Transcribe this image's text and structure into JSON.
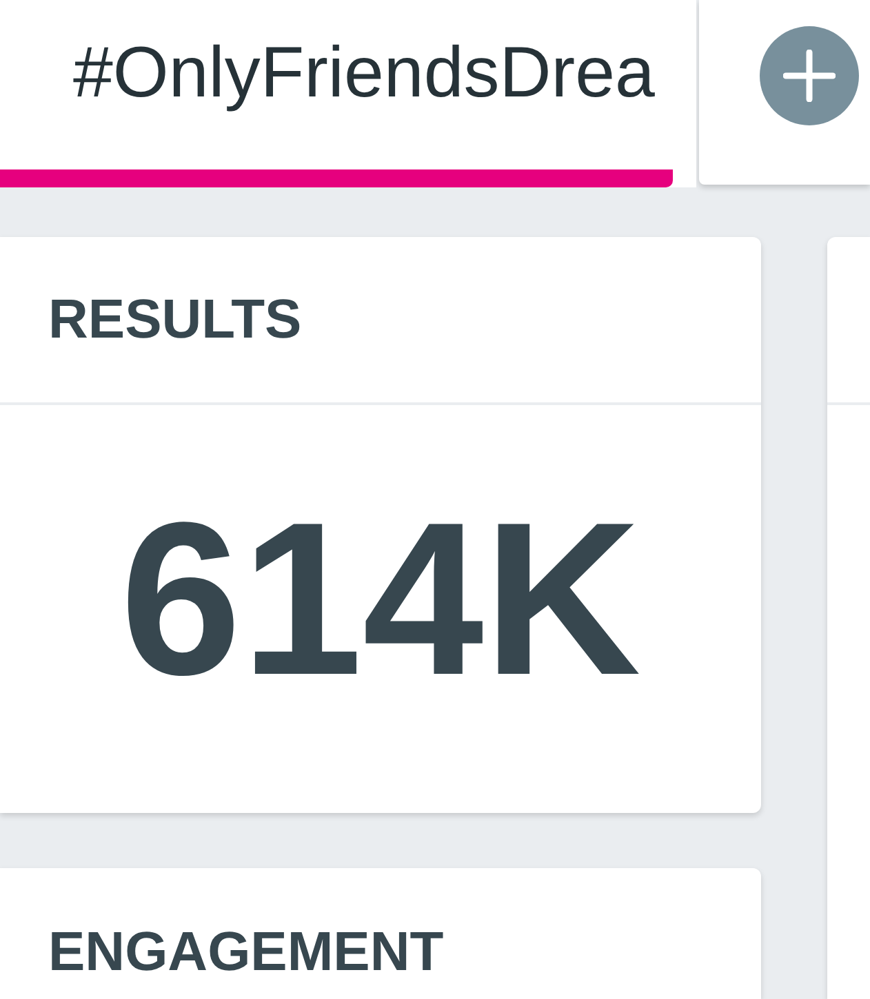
{
  "tabs": [
    {
      "label": "#OnlyFriendsDrea",
      "selected": true
    }
  ],
  "cards": [
    {
      "title": "RESULTS",
      "value": "614K"
    },
    {
      "title": "ENGAGEMENT"
    }
  ]
}
